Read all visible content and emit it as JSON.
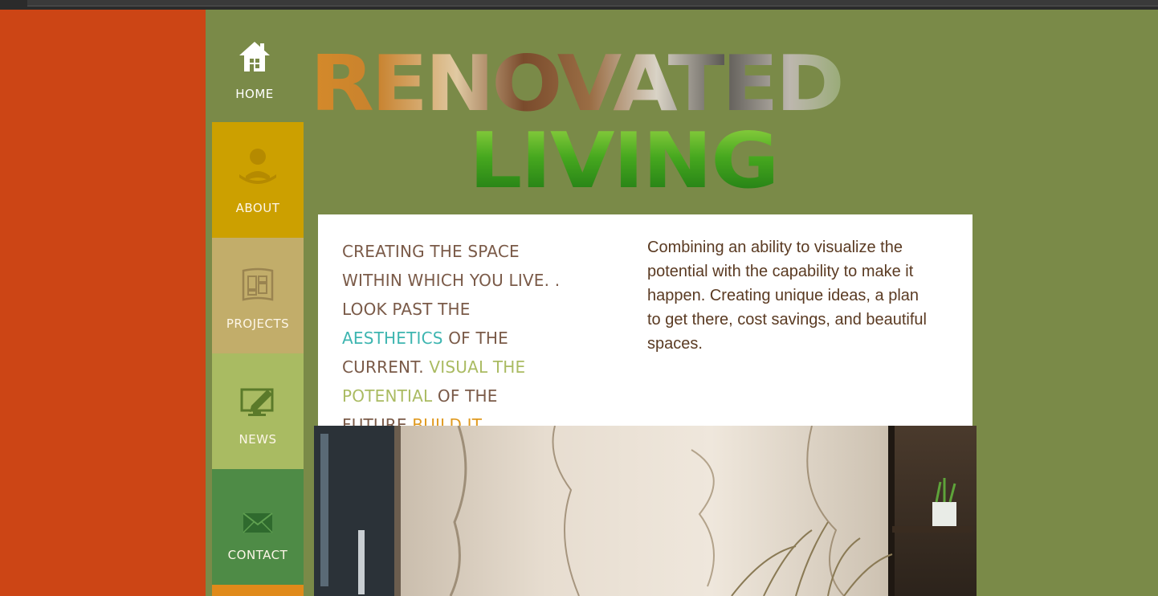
{
  "nav": {
    "home": "HOME",
    "about": "ABOUT",
    "projects": "PROJECTS",
    "news": "NEWS",
    "contact": "CONTACT"
  },
  "logo": {
    "line1": "RENOVATED",
    "line2": "LIVING"
  },
  "tagline": {
    "p1": "CREATING THE SPACE WITHIN WHICH YOU LIVE. . LOOK PAST THE ",
    "aesthetics": "AESTHETICS",
    "p2": " OF THE CURRENT. ",
    "visual": "VISUAL THE POTENTIAL",
    "p3": " OF THE FUTURE.",
    "build": "BUILD IT",
    "p4": ".."
  },
  "description": "Combining an ability to visualize the potential with the capability to make it happen. Creating unique ideas, a plan to get there, cost savings, and beautiful spaces.",
  "colors": {
    "background": "#7a8a48",
    "left_strip": "#cc4515",
    "about": "#cca000",
    "projects": "#c2ad6a",
    "news": "#a9bb62",
    "contact": "#4e8b46"
  },
  "icons": {
    "home": "home-icon",
    "about": "reader-icon",
    "projects": "blueprint-icon",
    "news": "monitor-pen-icon",
    "contact": "envelope-icon"
  }
}
